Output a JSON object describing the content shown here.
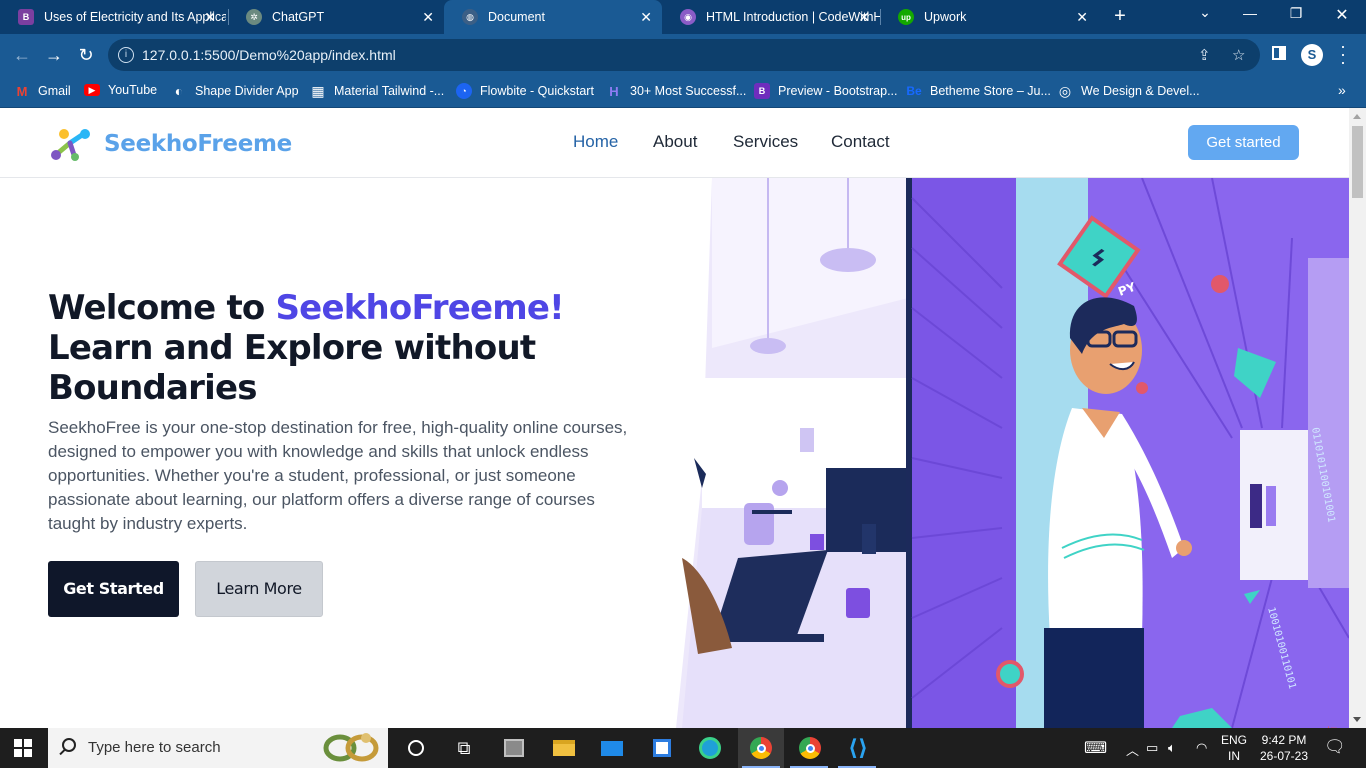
{
  "browser": {
    "tabs": [
      {
        "title": "Uses of Electricity and Its Applications",
        "fav_color": "#7b3fa0",
        "fav_glyph": "B"
      },
      {
        "title": "ChatGPT",
        "fav_color": "#6b8a80",
        "fav_glyph": "✲"
      },
      {
        "title": "Document",
        "fav_color": "#3b5f86",
        "fav_glyph": "◍"
      },
      {
        "title": "HTML Introduction | CodeWithHarry",
        "fav_color": "#8a5cc7",
        "fav_glyph": "◉"
      },
      {
        "title": "Upwork",
        "fav_color": "#14a800",
        "fav_glyph": "up"
      }
    ],
    "address": "127.0.0.1:5500/Demo%20app/index.html",
    "profile_initial": "S",
    "bookmarks": [
      {
        "label": "Gmail",
        "icon_color": "#ea4335",
        "glyph": "M"
      },
      {
        "label": "YouTube",
        "icon_color": "#ff0000",
        "glyph": "▶"
      },
      {
        "label": "Shape Divider App",
        "icon_color": "#ffffff",
        "glyph": "◐"
      },
      {
        "label": "Material Tailwind -...",
        "icon_color": "#ffffff",
        "glyph": "▦"
      },
      {
        "label": "Flowbite - Quickstart",
        "icon_color": "#1c64f2",
        "glyph": "◔"
      },
      {
        "label": "30+ Most Successf...",
        "icon_color": "#6c5ce7",
        "glyph": "H"
      },
      {
        "label": "Preview - Bootstrap...",
        "icon_color": "#6f2dbd",
        "glyph": "B"
      },
      {
        "label": "Betheme Store – Ju...",
        "icon_color": "#1769ff",
        "glyph": "Be"
      },
      {
        "label": "We Design & Devel...",
        "icon_color": "#ffffff",
        "glyph": "◎"
      }
    ]
  },
  "site": {
    "logo": "SeekhoFreeme",
    "nav": [
      "Home",
      "About",
      "Services",
      "Contact"
    ],
    "cta": "Get started",
    "hero": {
      "title_prefix": "Welcome to ",
      "title_highlight": "SeekhoFreeme!",
      "title_line2": "Learn and Explore without",
      "title_line3": "Boundaries",
      "description": "SeekhoFree is your one-stop destination for free, high-quality online courses, designed to empower you with knowledge and skills that unlock endless opportunities. Whether you're a student, professional, or just someone passionate about learning, our platform offers a diverse range of courses taught by industry experts.",
      "primary_button": "Get Started",
      "secondary_button": "Learn More"
    },
    "illustration_sign": "PY"
  },
  "colors": {
    "accent": "#4f46e5",
    "logo": "#5aa2e9",
    "cta": "#62a8f1",
    "illustration_purple": "#8a66ee"
  },
  "taskbar": {
    "search_placeholder": "Type here to search",
    "lang_top": "ENG",
    "lang_bottom": "IN",
    "time": "9:42 PM",
    "date": "26-07-23"
  }
}
